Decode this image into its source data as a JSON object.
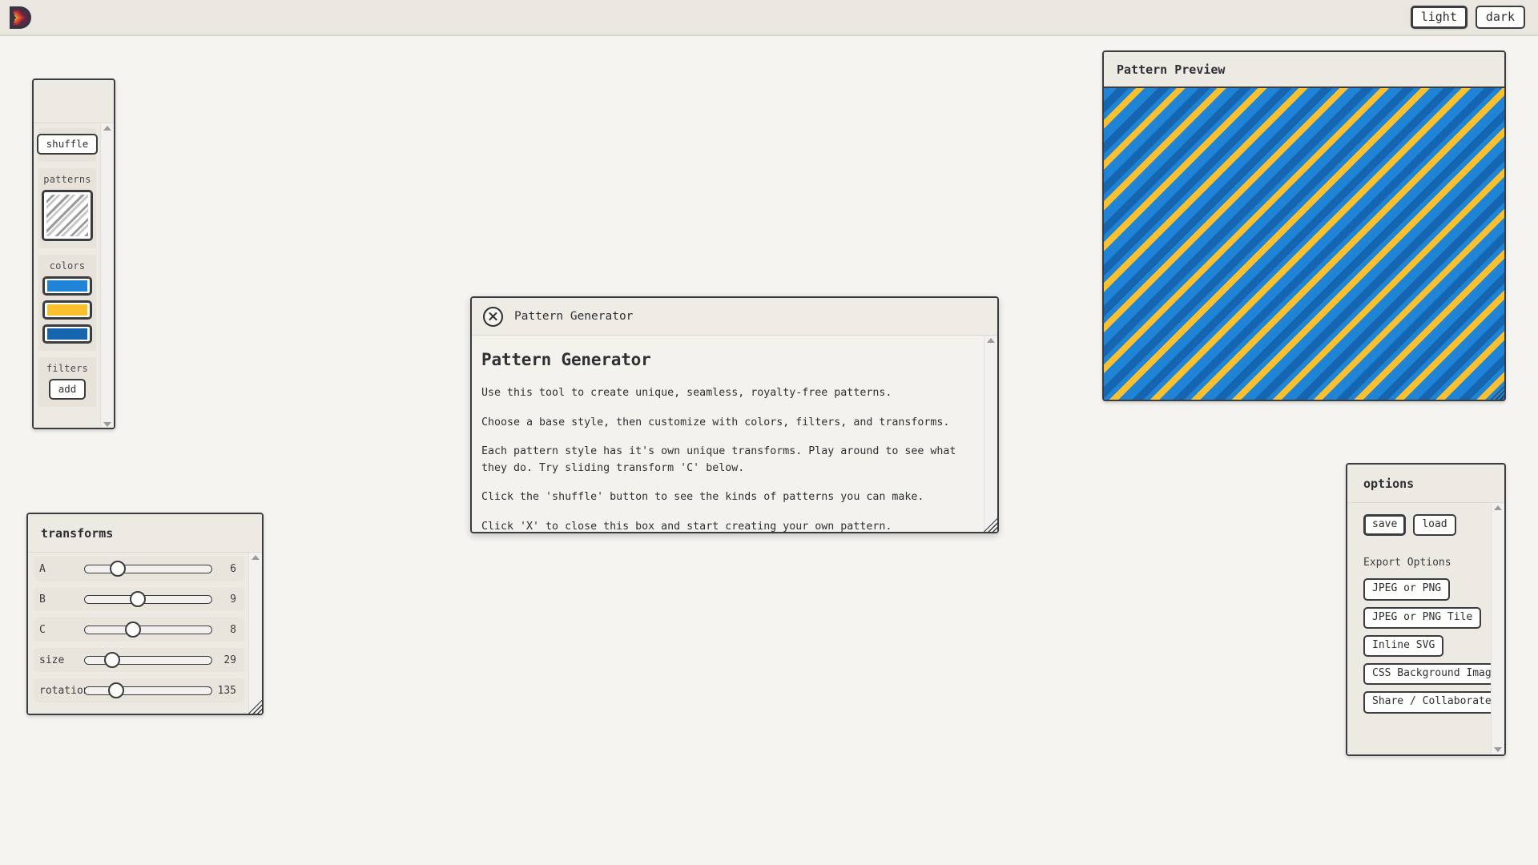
{
  "header": {
    "logo_name": "pattern-app-logo",
    "theme_buttons": [
      {
        "label": "light",
        "active": true
      },
      {
        "label": "dark",
        "active": false
      }
    ]
  },
  "left_panel": {
    "title": "",
    "shuffle_label": "shuffle",
    "groups": [
      {
        "name": "patterns",
        "label": "patterns"
      },
      {
        "name": "colors",
        "label": "colors"
      },
      {
        "name": "filters",
        "label": "filters"
      }
    ],
    "colors": [
      "#1f84d6",
      "#fbc02d",
      "#1565b0"
    ],
    "filters_add_label": "add"
  },
  "transforms_panel": {
    "title": "transforms",
    "sliders": [
      {
        "label": "A",
        "value": "6",
        "pct": 26
      },
      {
        "label": "B",
        "value": "9",
        "pct": 42
      },
      {
        "label": "C",
        "value": "8",
        "pct": 38
      },
      {
        "label": "size",
        "value": "29",
        "pct": 22
      },
      {
        "label": "rotation",
        "value": "135",
        "pct": 25
      }
    ]
  },
  "preview_panel": {
    "title": "Pattern Preview",
    "pattern": {
      "type": "diagonal-stripes",
      "angle_deg": 135,
      "base_color": "#1f84d6",
      "stripe_colors": [
        "#fbc02d",
        "#1565b0"
      ],
      "size": 29
    }
  },
  "options_panel": {
    "title": "options",
    "save_label": "save",
    "load_label": "load",
    "export_heading": "Export Options",
    "export_buttons": [
      "JPEG or PNG",
      "JPEG or PNG Tile",
      "Inline SVG",
      "CSS Background Image",
      "Share / Collaborate"
    ]
  },
  "modal": {
    "window_title": "Pattern Generator",
    "heading": "Pattern Generator",
    "paragraphs": [
      "Use this tool to create unique, seamless, royalty-free patterns.",
      "Choose a base style, then customize with colors, filters, and transforms.",
      "Each pattern style has it's own unique transforms. Play around to see what they do. Try sliding transform 'C' below.",
      "Click the 'shuffle' button to see the kinds of patterns you can make.",
      "Click 'X' to close this box and start creating your own pattern."
    ]
  }
}
